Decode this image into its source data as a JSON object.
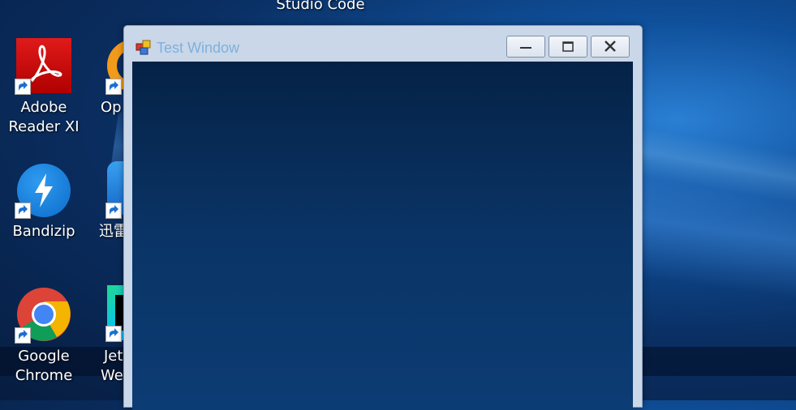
{
  "desktop": {
    "top_partial_label": "Studio Code",
    "icons": [
      {
        "name": "Adobe Reader XI",
        "line1": "Adobe",
        "line2": "Reader XI"
      },
      {
        "name": "Opera partial",
        "line1": "Op"
      },
      {
        "name": "Bandizip",
        "line1": "Bandizip"
      },
      {
        "name": "Xunlei partial",
        "line1": "迅雷"
      },
      {
        "name": "Google Chrome",
        "line1": "Google",
        "line2": "Chrome"
      },
      {
        "name": "JetBrains WebStorm partial",
        "line1": "Jet",
        "line2": "We"
      }
    ]
  },
  "window": {
    "title": "Test Window",
    "buttons": {
      "minimize": "minimize",
      "maximize": "maximize",
      "close": "close"
    }
  }
}
